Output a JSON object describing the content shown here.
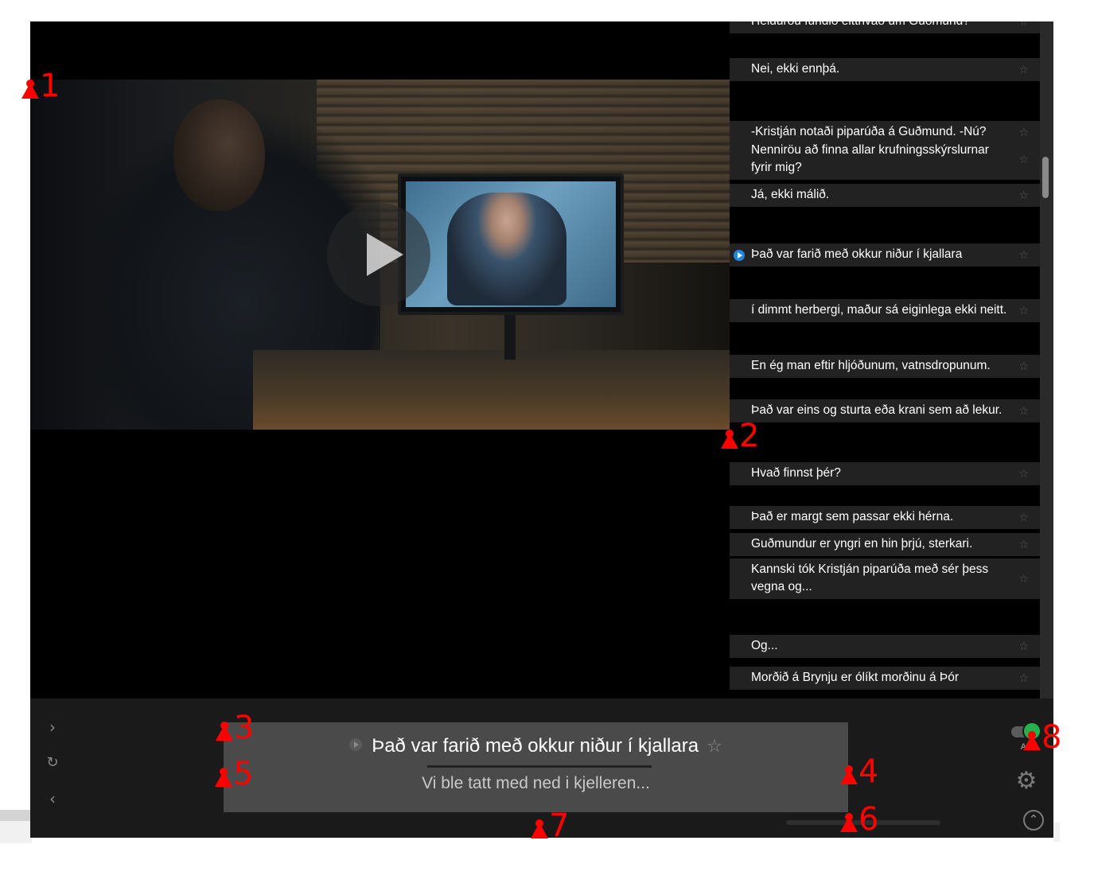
{
  "video": {
    "play_label": "Play"
  },
  "transcript": {
    "lines": [
      {
        "text": "Heldurðu fundið eitthvað um Guðmund?"
      },
      {
        "text": "Nei, ekki ennþá."
      },
      {
        "text": "-Kristján notaði piparúða á Guðmund. -Nú?"
      },
      {
        "text": "Nenniröu að finna allar krufningsskýrslurnar fyrir mig?"
      },
      {
        "text": "Já, ekki málið."
      },
      {
        "text": "Það var farið með okkur niður í kjallara",
        "active": true
      },
      {
        "text": "í dimmt herbergi, maður sá eiginlega ekki neitt."
      },
      {
        "text": "En ég man eftir hljóðunum, vatnsdropunum."
      },
      {
        "text": "Það var eins og sturta eða krani sem að lekur."
      },
      {
        "text": "Hvað finnst þér?"
      },
      {
        "text": "Það er margt sem passar ekki hérna."
      },
      {
        "text": "Guðmundur er yngri en hin þrjú, sterkari."
      },
      {
        "text": "Kannski tók Kristján piparúða með sér þess vegna og..."
      },
      {
        "text": "Og..."
      },
      {
        "text": "Morðið á Brynju er ólíkt morðinu á Þór"
      }
    ],
    "star_glyph": "☆",
    "active_color": "#1e88e5"
  },
  "subtitles": {
    "primary": "Það var farið með okkur niður í kjallara",
    "secondary": "Vi ble tatt med ned i kjelleren...",
    "star_glyph": "☆"
  },
  "controls": {
    "next_icon": "chevron-right-icon",
    "refresh_icon": "refresh-icon",
    "prev_icon": "chevron-left-icon",
    "autopause_label": "AP",
    "autopause_on": true,
    "toggle_color": "#22b14c",
    "settings_icon": "gear-icon",
    "collapse_icon": "chevron-up-circle-icon"
  },
  "annotations": [
    {
      "label": "1"
    },
    {
      "label": "2"
    },
    {
      "label": "3"
    },
    {
      "label": "4"
    },
    {
      "label": "5"
    },
    {
      "label": "6"
    },
    {
      "label": "7"
    },
    {
      "label": "8"
    }
  ]
}
